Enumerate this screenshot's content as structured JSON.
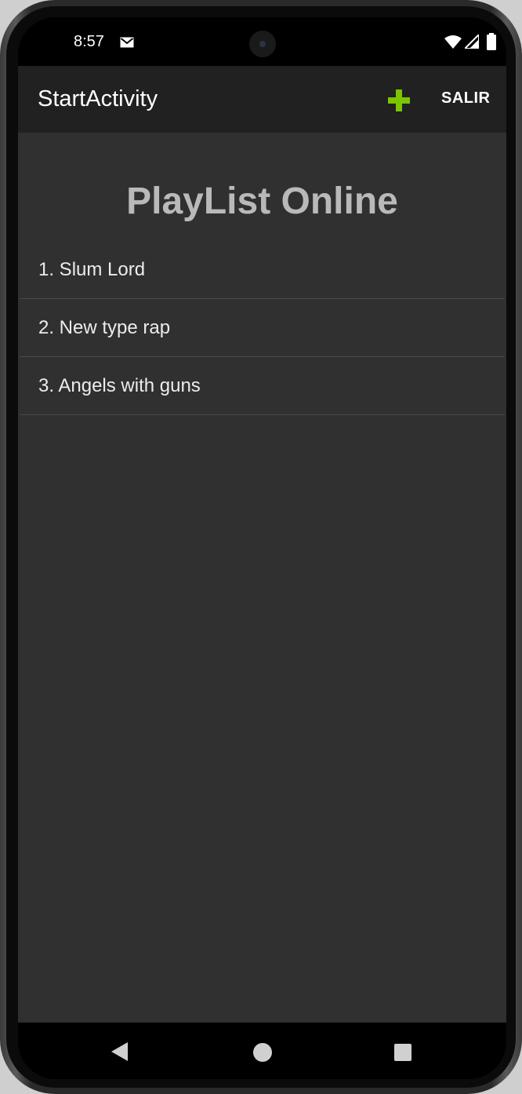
{
  "status_bar": {
    "time": "8:57",
    "icons": [
      "mail-icon",
      "wifi-icon",
      "signal-icon",
      "battery-icon"
    ]
  },
  "app_bar": {
    "title": "StartActivity",
    "add_icon": "plus-icon",
    "add_icon_color": "#7cc400",
    "exit_label": "SALIR"
  },
  "main": {
    "heading": "PlayList Online",
    "songs": [
      "1. Slum Lord",
      "2. New type rap",
      "3. Angels with guns"
    ]
  },
  "nav_bar": {
    "icons": [
      "back-icon",
      "home-icon",
      "recents-icon"
    ]
  },
  "colors": {
    "app_bar_bg": "#212121",
    "content_bg": "#303030",
    "heading_color": "#b9b9b9"
  }
}
